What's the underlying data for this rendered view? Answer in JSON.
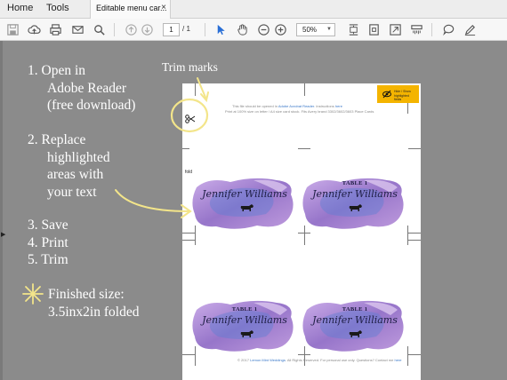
{
  "tabs": {
    "home": "Home",
    "tools": "Tools",
    "document": "Editable menu car...",
    "close": "×"
  },
  "toolbar": {
    "icons": [
      "save-icon",
      "upload-icon",
      "print-icon",
      "email-icon",
      "search-icon",
      "page-up-icon",
      "page-down-icon",
      "select-pointer-icon",
      "hand-icon",
      "zoom-out-icon",
      "zoom-in-icon",
      "fit-page-icon",
      "rotate-icon",
      "fullscreen-icon",
      "scroll-mode-icon",
      "comment-icon",
      "sign-icon"
    ],
    "page_current": "1",
    "page_total": "/ 1",
    "zoom": "50%"
  },
  "instructions": {
    "step1_line1": "1. Open in",
    "step1_line2": "Adobe Reader",
    "step1_line3": "(free download)",
    "step2_line1": "2. Replace",
    "step2_line2": "highlighted",
    "step2_line3": "areas with",
    "step2_line4": "your text",
    "step3": "3. Save",
    "step4": "4. Print",
    "step5": "5. Trim",
    "finished_line1": "Finished size:",
    "finished_line2": "3.5inx2in folded"
  },
  "trim_label": "Trim marks",
  "document": {
    "header_pre": "This file should be opened in",
    "header_link": "Adobe Acrobat Reader",
    "header_post": ". Instructions",
    "header_here": "here",
    "header_line2": "Print at 100% size on letter / A4 size card stock. Fits Avery brand 3302/3602/3603 Place Cards",
    "badge": "Hide / Show highlighted fields",
    "fold": "fold",
    "footer_pre": "© 2017",
    "footer_brand": "Lemon Mint Weddings",
    "footer_post": ". All Rights Reserved. For personal use only. Questions? Contact me",
    "footer_here": "here",
    "cards": [
      {
        "table": "",
        "name": "Jennifer Williams"
      },
      {
        "table": "TABLE 1",
        "name": "Jennifer Williams"
      },
      {
        "table": "TABLE 1",
        "name": "Jennifer Williams"
      },
      {
        "table": "TABLE 1",
        "name": "Jennifer Williams"
      }
    ]
  },
  "colors": {
    "annotation": "#f3e58a",
    "watercolor_purple": "#8b66c4",
    "watercolor_blue": "#5f7fd2",
    "badge": "#f4b400",
    "link": "#3a78c8"
  }
}
